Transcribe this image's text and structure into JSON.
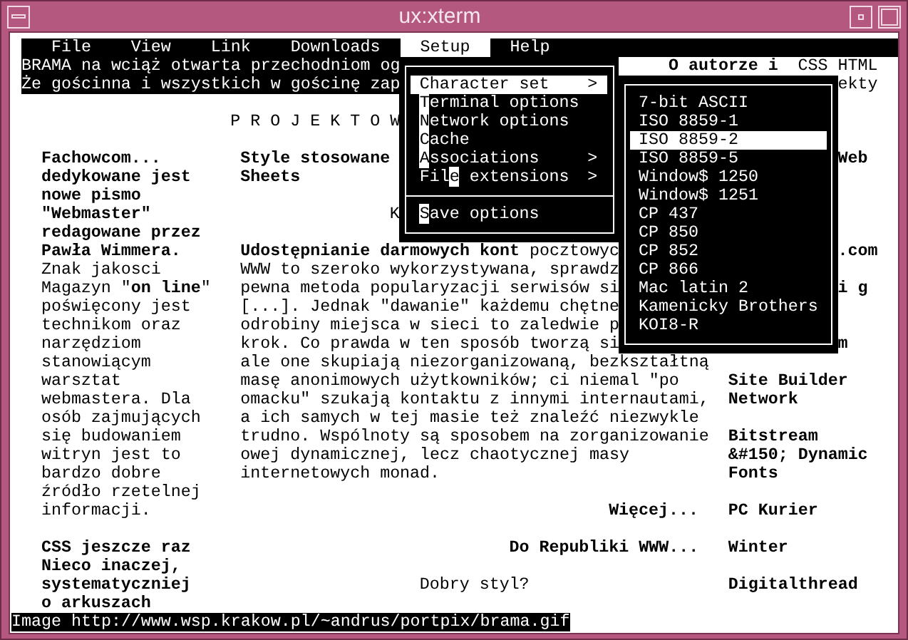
{
  "window": {
    "title": "ux:xterm"
  },
  "menubar": [
    {
      "label": "File",
      "selected": false
    },
    {
      "label": "View",
      "selected": false
    },
    {
      "label": "Link",
      "selected": false
    },
    {
      "label": "Downloads",
      "selected": false
    },
    {
      "label": "Setup",
      "selected": true
    },
    {
      "label": "Help",
      "selected": false
    }
  ],
  "page": {
    "blocks": [
      {
        "kind": "banner",
        "lines": [
          "BRAMA na wciąż otwarta przechodniom og",
          "Że gościnna i wszystkich w gościnę zap"
        ]
      },
      {
        "kind": "link",
        "lines": [
          "O autorze i"
        ]
      },
      {
        "kind": "text",
        "lines": [
          "CSS HTML"
        ]
      },
      {
        "kind": "text",
        "lines": [
          "ekty"
        ]
      },
      {
        "kind": "text",
        "lines": [
          "P R O J E K T O W"
        ]
      },
      {
        "kind": "link",
        "lines": [
          "Fachowcom...",
          "dedykowane jest",
          "nowe pismo",
          "\"Webmaster\"",
          "redagowane przez",
          "Pawła Wimmera."
        ]
      },
      {
        "kind": "link",
        "lines": [
          "Style stosowane",
          "Sheets"
        ]
      },
      {
        "kind": "link",
        "lines": [
          "Web"
        ]
      },
      {
        "kind": "text",
        "lines": [
          "K"
        ]
      },
      {
        "kind": "text",
        "lines": [
          "**Udostępnianie darmowych kont** pocztowyc",
          "WWW to szeroko wykorzystywana, sprawdz",
          "pewna metoda popularyzacji serwisów si",
          "[...]. Jednak \"dawanie\" każdemu chętne",
          "odrobiny miejsca w sieci to zaledwie p",
          "krok. Co prawda w ten sposób tworzą si"
        ]
      },
      {
        "kind": "link",
        "lines": [
          ".com"
        ]
      },
      {
        "kind": "text",
        "lines": [
          "Znak jakosci",
          "Magazyn \"**on line**\"",
          "poświęcony jest",
          "technikom oraz",
          "narzędziom",
          "stanowiącym",
          "warsztat",
          "webmastera. Dla",
          "osób zajmujących",
          "się budowaniem",
          "witryn jest to",
          "bardzo dobre",
          "źródło rzetelnej",
          "informacji."
        ]
      },
      {
        "kind": "link",
        "lines": [
          "i g"
        ]
      },
      {
        "kind": "link",
        "lines": [
          "m"
        ]
      },
      {
        "kind": "text",
        "lines": [
          "ale one skupiają niezorganizowaną, bezkształtną",
          "masę anonimowych użytkowników; ci niemal \"po",
          "omacku\" szukają kontaktu z innymi internautami,",
          "a ich samych w tej masie też znaleźć niezwykle",
          "trudno. Wspólnoty są sposobem na zorganizowanie",
          "owej dynamicznej, lecz chaotycznej masy",
          "internetowych monad."
        ]
      },
      {
        "kind": "link",
        "lines": [
          "Site Builder",
          "Network"
        ]
      },
      {
        "kind": "link",
        "lines": [
          "Bitstream",
          "&#150; Dynamic",
          "Fonts"
        ]
      },
      {
        "kind": "link",
        "lines": [
          "Więcej..."
        ]
      },
      {
        "kind": "link",
        "lines": [
          "PC Kurier"
        ]
      },
      {
        "kind": "link",
        "lines": [
          "CSS jeszcze raz"
        ]
      },
      {
        "kind": "link",
        "lines": [
          "Do Republiki WWW..."
        ]
      },
      {
        "kind": "link",
        "lines": [
          "Winter"
        ]
      },
      {
        "kind": "link",
        "lines": [
          "Nieco inaczej,",
          "systematyczniej",
          "o arkuszach"
        ]
      },
      {
        "kind": "text",
        "lines": [
          "Dobry styl?"
        ]
      },
      {
        "kind": "link",
        "lines": [
          "Digitalthread"
        ]
      }
    ]
  },
  "setup_menu": {
    "items": [
      {
        "kind": "item",
        "key": "C",
        "after": "haracter set",
        "arrow": ">",
        "selected": true
      },
      {
        "kind": "item",
        "key": "T",
        "after": "erminal options",
        "selected": false
      },
      {
        "kind": "item",
        "key": "N",
        "after": "etwork options",
        "selected": false
      },
      {
        "kind": "item",
        "key": "C",
        "after": "ache",
        "selected": false
      },
      {
        "kind": "item",
        "key": "A",
        "after": "ssociations",
        "arrow": ">",
        "selected": false
      },
      {
        "kind": "item",
        "before": "Fil",
        "key": "e",
        "after": " extensions",
        "arrow": ">",
        "selected": false
      },
      {
        "kind": "separator"
      },
      {
        "kind": "item",
        "key": "S",
        "after": "ave options",
        "selected": false
      }
    ]
  },
  "charset_menu": {
    "items": [
      {
        "label": "7-bit ASCII",
        "selected": false
      },
      {
        "label": "ISO 8859-1",
        "selected": false
      },
      {
        "label": "ISO 8859-2",
        "selected": true
      },
      {
        "label": "ISO 8859-5",
        "selected": false
      },
      {
        "label": "Window$ 1250",
        "selected": false
      },
      {
        "label": "Window$ 1251",
        "selected": false
      },
      {
        "label": "CP 437",
        "selected": false
      },
      {
        "label": "CP 850",
        "selected": false
      },
      {
        "label": "CP 852",
        "selected": false
      },
      {
        "label": "CP 866",
        "selected": false
      },
      {
        "label": "Mac latin 2",
        "selected": false
      },
      {
        "label": "Kamenicky Brothers",
        "selected": false
      },
      {
        "label": "KOI8-R",
        "selected": false
      }
    ]
  },
  "status_bar": "Image http://www.wsp.krakow.pl/~andrus/portpix/brama.gif"
}
